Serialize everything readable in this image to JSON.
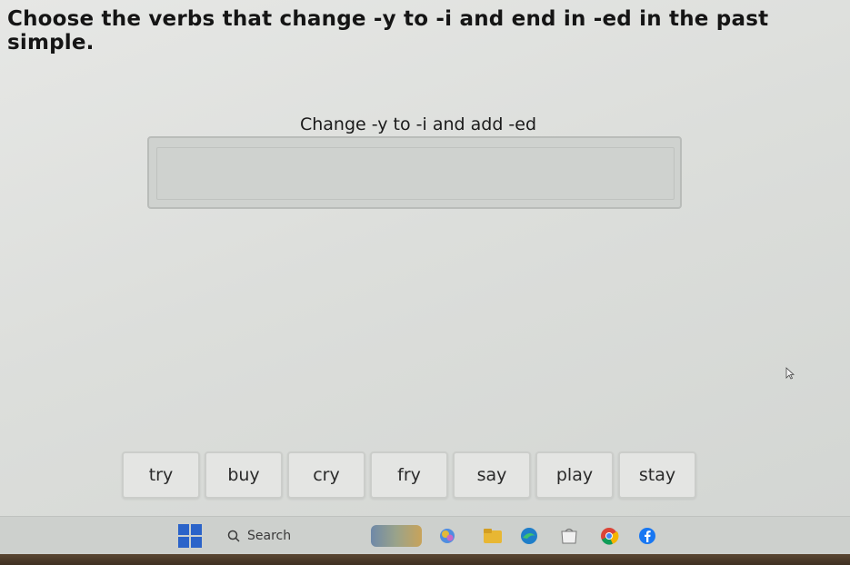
{
  "question": "Choose the verbs that change -y to -i and end in -ed in the past simple.",
  "drop_zone": {
    "label": "Change -y to -i and add -ed"
  },
  "word_bank": [
    "try",
    "buy",
    "cry",
    "fry",
    "say",
    "play",
    "stay"
  ],
  "taskbar": {
    "search_label": "Search",
    "icons": [
      "windows-start-icon",
      "search-icon",
      "widgets-icon",
      "copilot-icon",
      "file-explorer-icon",
      "edge-icon",
      "store-icon",
      "chrome-icon",
      "facebook-icon"
    ]
  },
  "colors": {
    "tile_bg": "#e4e5e3",
    "drop_zone_bg": "#cfd2cf",
    "accent_blue": "#2b63c9"
  }
}
